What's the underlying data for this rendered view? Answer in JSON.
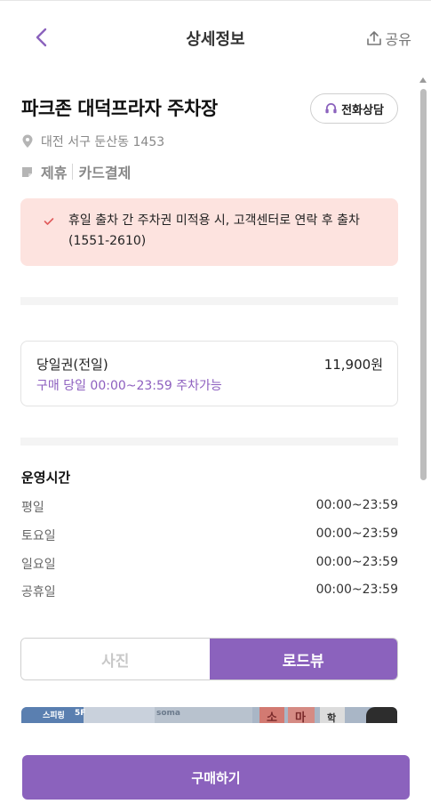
{
  "header": {
    "title": "상세정보",
    "share_label": "공유"
  },
  "place": {
    "name": "파크존 대덕프라자 주차장",
    "call_label": "전화상담",
    "address": "대전 서구 둔산동 1453",
    "tags": [
      "제휴",
      "카드결제"
    ]
  },
  "notice": {
    "text": "휴일 출차 간 주차권 미적용 시, 고객센터로 연락 후 출차 (1551-2610)"
  },
  "ticket": {
    "name": "당일권(전일)",
    "price": "11,900원",
    "description": "구매 당일 00:00~23:59 주차가능"
  },
  "hours": {
    "title": "운영시간",
    "rows": [
      {
        "day": "평일",
        "time": "00:00~23:59"
      },
      {
        "day": "토요일",
        "time": "00:00~23:59"
      },
      {
        "day": "일요일",
        "time": "00:00~23:59"
      },
      {
        "day": "공휴일",
        "time": "00:00~23:59"
      }
    ]
  },
  "tabs": {
    "photo_label": "사진",
    "roadview_label": "로드뷰",
    "active": "roadview"
  },
  "roadview_signs": [
    "스피링",
    "5F",
    "soma",
    "소",
    "마",
    "학"
  ],
  "footer": {
    "buy_label": "구매하기"
  },
  "colors": {
    "accent": "#8b62bd",
    "notice_bg": "#fde3df",
    "notice_check": "#e05a5a"
  }
}
